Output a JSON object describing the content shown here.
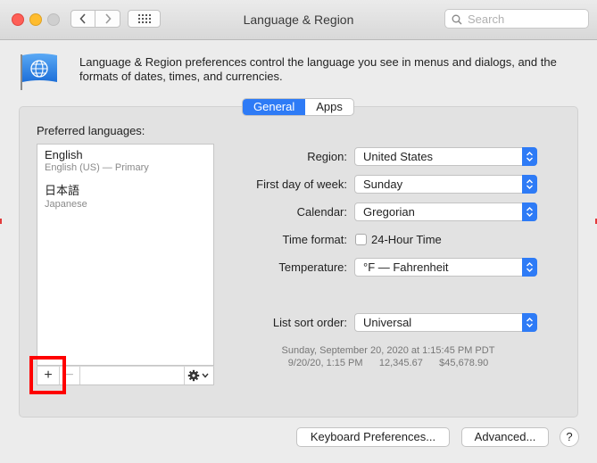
{
  "window": {
    "title": "Language & Region"
  },
  "search": {
    "placeholder": "Search"
  },
  "header": {
    "description": "Language & Region preferences control the language you see in menus and dialogs, and the formats of dates, times, and currencies."
  },
  "tabs": [
    {
      "label": "General",
      "active": true
    },
    {
      "label": "Apps",
      "active": false
    }
  ],
  "preferred": {
    "label": "Preferred languages:",
    "languages": [
      {
        "name": "English",
        "sub": "English (US) — Primary"
      },
      {
        "name": "日本語",
        "sub": "Japanese"
      }
    ],
    "add": "+",
    "remove": "−"
  },
  "settings": {
    "region": {
      "label": "Region:",
      "value": "United States"
    },
    "first_day": {
      "label": "First day of week:",
      "value": "Sunday"
    },
    "calendar": {
      "label": "Calendar:",
      "value": "Gregorian"
    },
    "time_format": {
      "label": "Time format:",
      "checkbox_label": "24-Hour Time",
      "checked": false
    },
    "temperature": {
      "label": "Temperature:",
      "value": "°F — Fahrenheit"
    },
    "sort_order": {
      "label": "List sort order:",
      "value": "Universal"
    }
  },
  "sample": {
    "line1": "Sunday, September 20, 2020 at 1:15:45 PM PDT",
    "line2": "9/20/20, 1:15 PM      12,345.67      $45,678.90"
  },
  "buttons": {
    "keyboard": "Keyboard Preferences...",
    "advanced": "Advanced...",
    "help": "?"
  },
  "colors": {
    "accent": "#2e7bf6",
    "highlight": "#ff0000"
  }
}
